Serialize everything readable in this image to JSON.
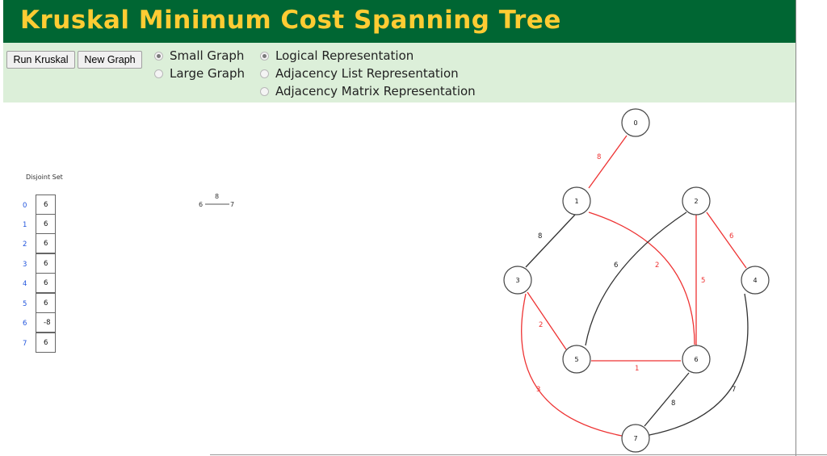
{
  "header": {
    "title": "Kruskal Minimum Cost Spanning Tree"
  },
  "toolbar": {
    "run_label": "Run Kruskal",
    "new_graph_label": "New Graph",
    "graph_size": [
      {
        "label": "Small Graph",
        "checked": true
      },
      {
        "label": "Large Graph",
        "checked": false
      }
    ],
    "representation": [
      {
        "label": "Logical Representation",
        "checked": true
      },
      {
        "label": "Adjacency List Representation",
        "checked": false
      },
      {
        "label": "Adjacency Matrix Representation",
        "checked": false
      }
    ]
  },
  "disjoint_set": {
    "title": "Disjoint Set",
    "entries": [
      {
        "index": "0",
        "value": "6"
      },
      {
        "index": "1",
        "value": "6"
      },
      {
        "index": "2",
        "value": "6"
      },
      {
        "index": "3",
        "value": "6"
      },
      {
        "index": "4",
        "value": "6"
      },
      {
        "index": "5",
        "value": "6"
      },
      {
        "index": "6",
        "value": "-8"
      },
      {
        "index": "7",
        "value": "6"
      }
    ]
  },
  "current_edge": {
    "from": "6",
    "to": "7",
    "weight": "8"
  },
  "graph": {
    "colors": {
      "tree_edge": "#ee3333",
      "normal_edge": "#333333",
      "node_stroke": "#444444"
    },
    "nodes": [
      "0",
      "1",
      "2",
      "3",
      "4",
      "5",
      "6",
      "7"
    ],
    "edges": [
      {
        "from": "0",
        "to": "1",
        "weight": "8",
        "in_tree": true
      },
      {
        "from": "1",
        "to": "3",
        "weight": "8",
        "in_tree": false
      },
      {
        "from": "1",
        "to": "6",
        "weight": "2",
        "in_tree": true
      },
      {
        "from": "2",
        "to": "5",
        "weight": "6",
        "in_tree": false
      },
      {
        "from": "2",
        "to": "6",
        "weight": "5",
        "in_tree": true
      },
      {
        "from": "2",
        "to": "4",
        "weight": "6",
        "in_tree": true
      },
      {
        "from": "3",
        "to": "5",
        "weight": "2",
        "in_tree": true
      },
      {
        "from": "3",
        "to": "7",
        "weight": "3",
        "in_tree": true
      },
      {
        "from": "5",
        "to": "6",
        "weight": "1",
        "in_tree": true
      },
      {
        "from": "6",
        "to": "7",
        "weight": "8",
        "in_tree": false
      },
      {
        "from": "4",
        "to": "7",
        "weight": "7",
        "in_tree": false
      }
    ]
  }
}
